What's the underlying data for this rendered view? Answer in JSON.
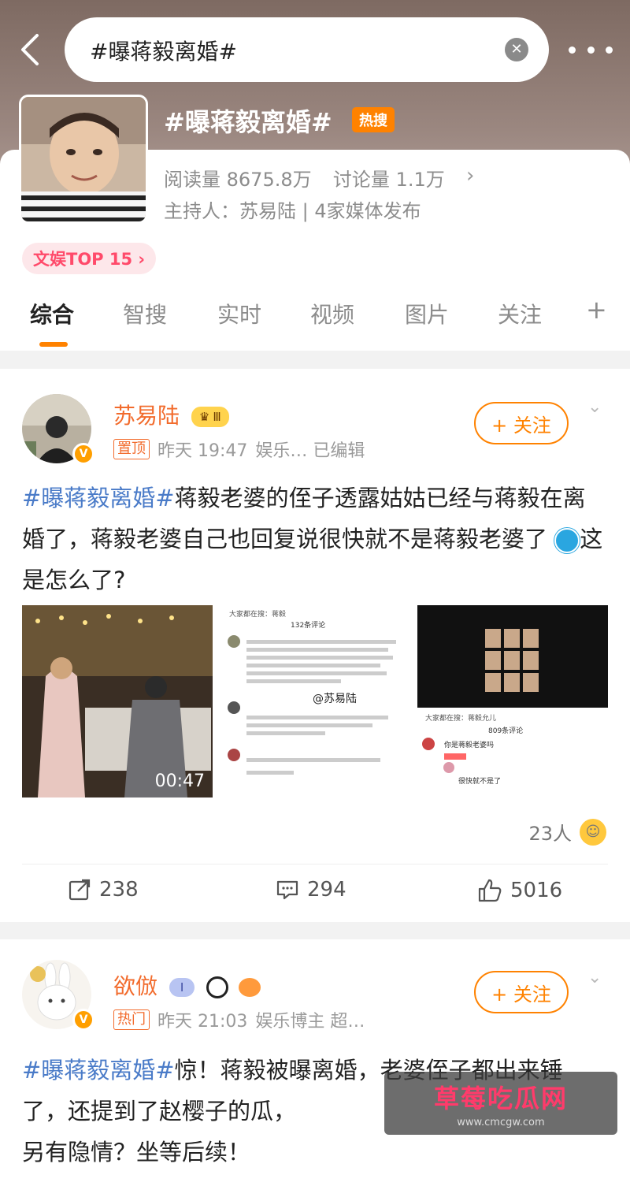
{
  "search": {
    "query": "#曝蒋毅离婚#"
  },
  "topic": {
    "title": "#曝蒋毅离婚#",
    "hot_badge": "热搜",
    "reads_label": "阅读量",
    "reads": "8675.8万",
    "discuss_label": "讨论量",
    "discuss": "1.1万",
    "host_line": "主持人：苏易陆 | 4家媒体发布",
    "rank": "文娱TOP 15 ›"
  },
  "tabs": [
    {
      "label": "综合"
    },
    {
      "label": "智搜"
    },
    {
      "label": "实时"
    },
    {
      "label": "视频"
    },
    {
      "label": "图片"
    },
    {
      "label": "关注"
    },
    {
      "label": "+"
    }
  ],
  "posts": [
    {
      "username": "苏易陆",
      "level_badge": "Ⅲ",
      "tag": "置顶",
      "time": "昨天 19:47",
      "meta_extra": "娱乐… 已编辑",
      "follow_label": "+ 关注",
      "hashtag": "#曝蒋毅离婚#",
      "text": "蒋毅老婆的侄子透露姑姑已经与蒋毅在离婚了，蒋毅老婆自己也回复说很快就不是蒋毅老婆了",
      "text_tail": "这是怎么了?",
      "video_duration": "00:47",
      "img2_header": "大家都在搜：蒋毅",
      "img2_count": "132条评论",
      "img2_watermark": "@苏易陆",
      "img3_header": "大家都在搜：蒋毅允儿",
      "img3_count": "809条评论",
      "img3_reply1": "你是蒋毅老婆吗",
      "img3_reply2": "很快就不是了",
      "reactions_count": "23人",
      "reposts": "238",
      "comments": "294",
      "likes": "5016"
    },
    {
      "username": "欲倣",
      "level_badge": "I",
      "tag": "热门",
      "time": "昨天 21:03",
      "meta_extra": "娱乐博主 超…",
      "follow_label": "+ 关注",
      "hashtag": "#曝蒋毅离婚#",
      "text": "惊！蒋毅被曝离婚，老婆侄子都出来锤了，还提到了赵樱子的瓜，",
      "text_tail": "另有隐情？坐等后续！"
    }
  ],
  "watermark": {
    "main": "草莓吃瓜网",
    "sub": "www.cmcgw.com"
  },
  "colors": {
    "accent": "#ff8200",
    "hashtag": "#4a7bc8",
    "username": "#f26b2c"
  }
}
